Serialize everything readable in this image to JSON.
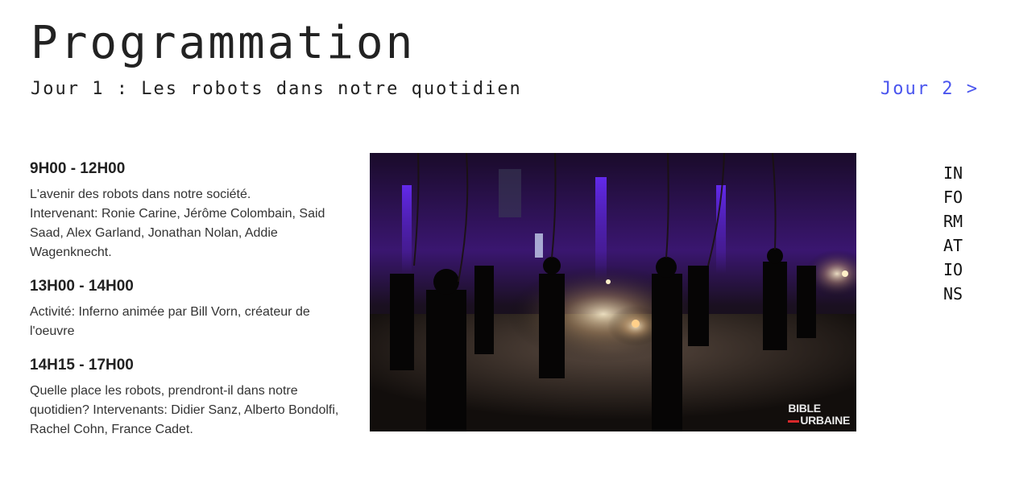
{
  "page": {
    "title": "Programmation",
    "day_heading": "Jour 1 : Les robots dans notre quotidien",
    "next_day_link": "Jour 2 >"
  },
  "schedule": [
    {
      "time": "9H00 - 12H00",
      "lines": [
        "L'avenir des robots dans notre société.",
        "Intervenant: Ronie Carine, Jérôme Colombain, Said Saad, Alex Garland, Jonathan Nolan, Addie Wagenknecht."
      ]
    },
    {
      "time": "13H00 - 14H00",
      "lines": [
        "Activité: Inferno animée par Bill Vorn, créateur de l'oeuvre"
      ]
    },
    {
      "time": "14H15 - 17H00",
      "lines": [
        "Quelle place les robots, prendront-il dans notre quotidien? Intervenants: Didier Sanz, Alberto Bondolfi, Rachel Cohn, France Cadet."
      ]
    }
  ],
  "photo": {
    "watermark_line1": "BIBLE",
    "watermark_line2": "URBAINE"
  },
  "side_tab": {
    "label": "INFORMATIONS"
  },
  "colors": {
    "link": "#4a55ee",
    "text": "#222222",
    "background": "#ffffff"
  }
}
